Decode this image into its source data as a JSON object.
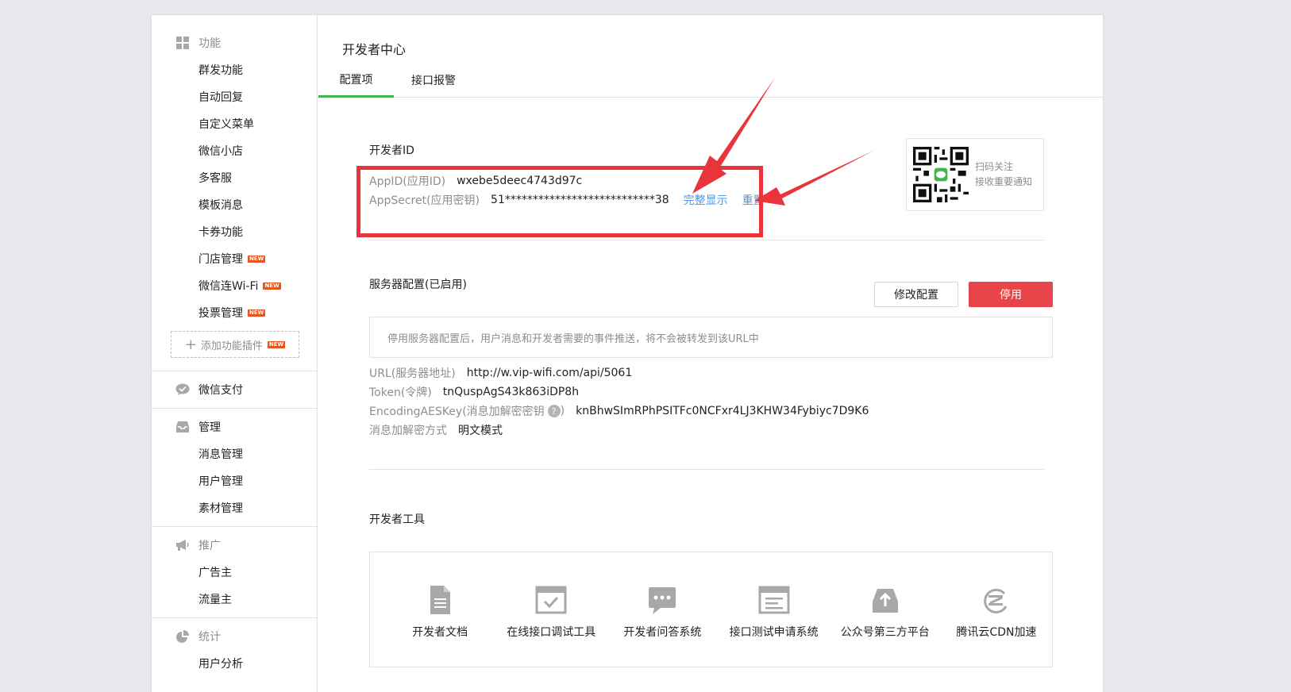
{
  "sidebar": {
    "groups": [
      {
        "title": "功能",
        "icon": "grid-icon",
        "items": [
          {
            "label": "群发功能"
          },
          {
            "label": "自动回复"
          },
          {
            "label": "自定义菜单"
          },
          {
            "label": "微信小店"
          },
          {
            "label": "多客服"
          },
          {
            "label": "模板消息"
          },
          {
            "label": "卡券功能"
          },
          {
            "label": "门店管理",
            "badge": "NEW"
          },
          {
            "label": "微信连Wi-Fi",
            "badge": "NEW"
          },
          {
            "label": "投票管理",
            "badge": "NEW"
          }
        ],
        "add_plugin": {
          "label": "添加功能插件",
          "badge": "NEW"
        }
      },
      {
        "title": "微信支付",
        "icon": "wechat-pay-icon",
        "items": []
      },
      {
        "title": "管理",
        "icon": "inbox-icon",
        "items": [
          {
            "label": "消息管理"
          },
          {
            "label": "用户管理"
          },
          {
            "label": "素材管理"
          }
        ]
      },
      {
        "title": "推广",
        "icon": "megaphone-icon",
        "items": [
          {
            "label": "广告主"
          },
          {
            "label": "流量主"
          }
        ]
      },
      {
        "title": "统计",
        "icon": "pie-chart-icon",
        "items": [
          {
            "label": "用户分析"
          }
        ]
      }
    ]
  },
  "main": {
    "title": "开发者中心",
    "tabs": [
      {
        "label": "配置项",
        "active": true
      },
      {
        "label": "接口报警",
        "active": false
      }
    ],
    "developer_id": {
      "label": "开发者ID",
      "appid_key": "AppID(应用ID)",
      "appid_value": "wxebe5deec4743d97c",
      "secret_key": "AppSecret(应用密钥)",
      "secret_value": "51***************************38",
      "show_full": "完整显示",
      "reset": "重置"
    },
    "qr": {
      "line1": "扫码关注",
      "line2": "接收重要通知"
    },
    "server": {
      "label": "服务器配置(已启用)",
      "modify_button": "修改配置",
      "disable_button": "停用",
      "notice": "停用服务器配置后，用户消息和开发者需要的事件推送，将不会被转发到该URL中",
      "url_key": "URL(服务器地址)",
      "url_value": "http://w.vip-wifi.com/api/5061",
      "token_key": "Token(令牌)",
      "token_value": "tnQuspAgS43k863iDP8h",
      "aes_key_label": "EncodingAESKey(消息加解密密钥",
      "aes_key_close": ")",
      "aes_value": "knBhwSImRPhPSITFc0NCFxr4LJ3KHW34Fybiyc7D9K6",
      "mode_key": "消息加解密方式",
      "mode_value": "明文模式"
    },
    "tools": {
      "label": "开发者工具",
      "items": [
        {
          "label": "开发者文档",
          "icon": "document-icon"
        },
        {
          "label": "在线接口调试工具",
          "icon": "debug-window-icon"
        },
        {
          "label": "开发者问答系统",
          "icon": "chat-bubble-icon"
        },
        {
          "label": "接口测试申请系统",
          "icon": "test-window-icon"
        },
        {
          "label": "公众号第三方平台",
          "icon": "upload-tray-icon"
        },
        {
          "label": "腾讯云CDN加速",
          "icon": "cloud-cdn-icon"
        }
      ]
    }
  },
  "colors": {
    "accent": "#44b549",
    "danger": "#e8454a",
    "link": "#459ae9",
    "annotation": "#e8343a"
  }
}
